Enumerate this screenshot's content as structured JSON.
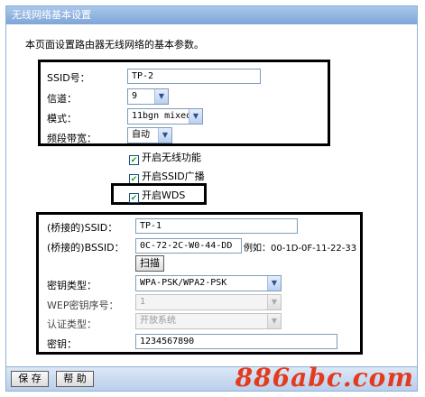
{
  "title": "无线网络基本设置",
  "intro": "本页面设置路由器无线网络的基本参数。",
  "basic": {
    "ssid_label": "SSID号：",
    "ssid_value": "TP-2",
    "channel_label": "信道：",
    "channel_value": "9",
    "mode_label": "模式：",
    "mode_value": "11bgn mixed",
    "bandwidth_label": "频段带宽：",
    "bandwidth_value": "自动"
  },
  "checkboxes": {
    "wireless_enable": "开启无线功能",
    "ssid_broadcast": "开启SSID广播",
    "wds_enable": "开启WDS"
  },
  "wds": {
    "bridged_ssid_label": "(桥接的)SSID：",
    "bridged_ssid_value": "TP-1",
    "bridged_bssid_label": "(桥接的)BSSID：",
    "bridged_bssid_value": "0C-72-2C-W0-44-DD",
    "bssid_example": "例如：00-1D-0F-11-22-33",
    "scan_label": "扫描",
    "key_type_label": "密钥类型：",
    "key_type_value": "WPA-PSK/WPA2-PSK",
    "wep_index_label": "WEP密钥序号：",
    "wep_index_value": "1",
    "auth_type_label": "认证类型：",
    "auth_type_value": "开放系统",
    "key_label": "密钥：",
    "key_value": "1234567890"
  },
  "footer": {
    "save_label": "保 存",
    "help_label": "帮 助"
  },
  "watermark": "886abc.com",
  "colors": {
    "title_bar": "#7ea6d8",
    "check": "#21a121",
    "watermark": "#e33b1e"
  }
}
